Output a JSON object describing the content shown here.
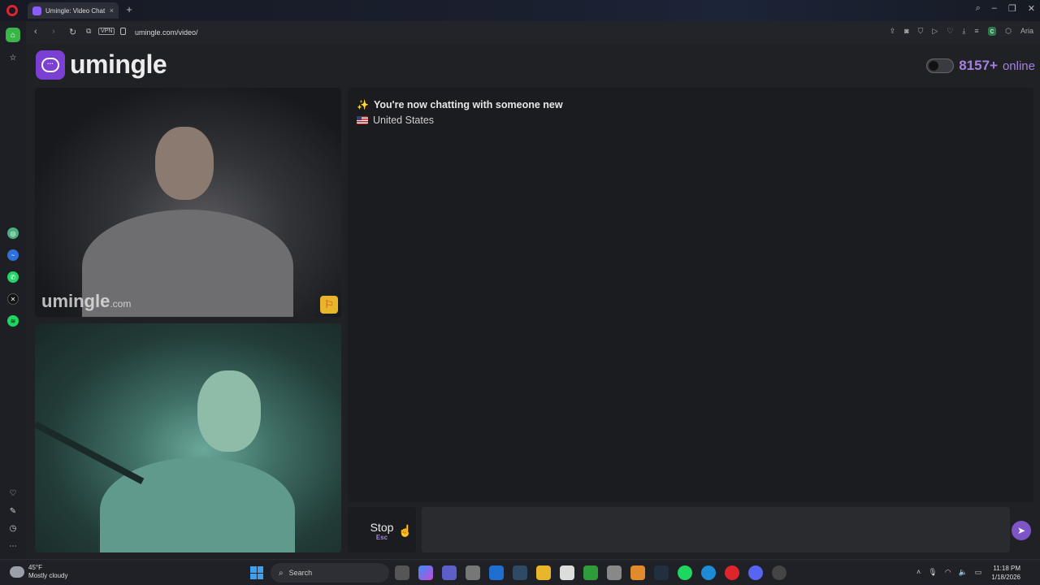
{
  "browser": {
    "tab_title": "Umingle: Video Chat",
    "tab_close": "×",
    "new_tab": "+",
    "url": "umingle.com/video/",
    "vpn_label": "VPN",
    "ai_label": "Aria"
  },
  "site": {
    "brand_name": "umingle",
    "online_count": "8157+",
    "online_label": "online",
    "watermark_name": "umingle",
    "watermark_tld": ".com"
  },
  "chat": {
    "status_message": "You're now chatting with someone new",
    "country": "United States",
    "input_value": "",
    "input_placeholder": ""
  },
  "controls": {
    "stop_label": "Stop",
    "stop_key": "Esc"
  },
  "taskbar": {
    "weather_temp": "45°F",
    "weather_desc": "Mostly cloudy",
    "search_label": "Search",
    "time": "11:18 PM",
    "date": "1/18/2026"
  },
  "colors": {
    "accent_purple": "#7c3fd3",
    "online_purple": "#a680e0",
    "opera_red": "#e0242b",
    "sidebar_home_green": "#3bb54a"
  }
}
